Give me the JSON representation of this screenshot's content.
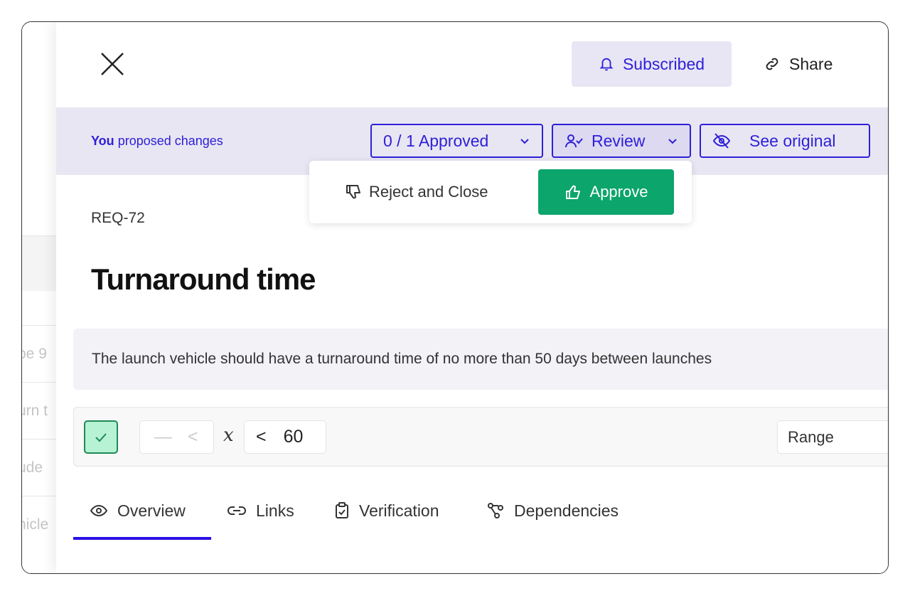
{
  "background_list": {
    "rows": [
      "be 9",
      "urn t",
      "ude",
      "hicle"
    ]
  },
  "header": {
    "subscribed_label": "Subscribed",
    "share_label": "Share"
  },
  "proposal_bar": {
    "you": "You",
    "text": "proposed changes",
    "approved_label": "0 / 1 Approved",
    "review_label": "Review",
    "see_original_label": "See original"
  },
  "review_menu": {
    "reject_label": "Reject and Close",
    "approve_label": "Approve"
  },
  "requirement": {
    "id": "REQ-72",
    "title": "Turnaround time",
    "description": "The launch vehicle should have a turnaround time of no more than 50 days between launches"
  },
  "criteria": {
    "checked": true,
    "lower_value": "—",
    "lower_op": "<",
    "variable": "x",
    "upper_op": "<",
    "upper_value": "60",
    "type": "Range"
  },
  "tabs": [
    {
      "label": "Overview",
      "active": true
    },
    {
      "label": "Links"
    },
    {
      "label": "Verification"
    },
    {
      "label": "Dependencies"
    }
  ],
  "colors": {
    "accent": "#2f20d8",
    "approve": "#0ca56c",
    "bar_bg": "#e8e6f2"
  }
}
